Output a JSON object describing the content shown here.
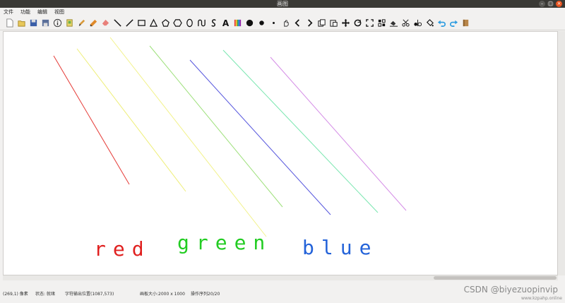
{
  "window": {
    "title": "画图"
  },
  "menu": [
    "文件",
    "功能",
    "编辑",
    "视图"
  ],
  "toolbar": {
    "tools": [
      "new-file",
      "open-folder",
      "save",
      "save-as",
      "info",
      "export",
      "brush",
      "pencil",
      "eraser",
      "line",
      "line-thick",
      "rectangle",
      "triangle",
      "pentagon",
      "hexagon",
      "ellipse",
      "curve",
      "s-curve",
      "text",
      "color-palette",
      "fill-large",
      "fill-medium",
      "fill-small",
      "pan-hand",
      "prev",
      "next",
      "copy",
      "paste",
      "move",
      "rotate",
      "fullscreen",
      "crop",
      "bucket",
      "scissors",
      "flip",
      "paint-bucket",
      "undo",
      "redo",
      "book"
    ],
    "text_tool_label": "A"
  },
  "canvas": {
    "labels": [
      {
        "text": "red",
        "color": "#e0201f"
      },
      {
        "text": "green",
        "color": "#22cc22"
      },
      {
        "text": "blue",
        "color": "#2463d9"
      }
    ],
    "line_colors": [
      "#e53935",
      "#eeee77",
      "#f2f28a",
      "#9de07a",
      "#5555dd",
      "#7ae6b0",
      "#d48ce6"
    ]
  },
  "status": {
    "coord": "(269,1) 像素",
    "state": "状态: 就绪",
    "text_pos": "字符输出位置(1087,573)",
    "canvas_size": "画板大小:2000 x 1000",
    "ops": "操作序列20/20"
  },
  "watermark": {
    "main": "CSDN @biyezuopinvip",
    "sub": "www.kzpahp.online"
  }
}
